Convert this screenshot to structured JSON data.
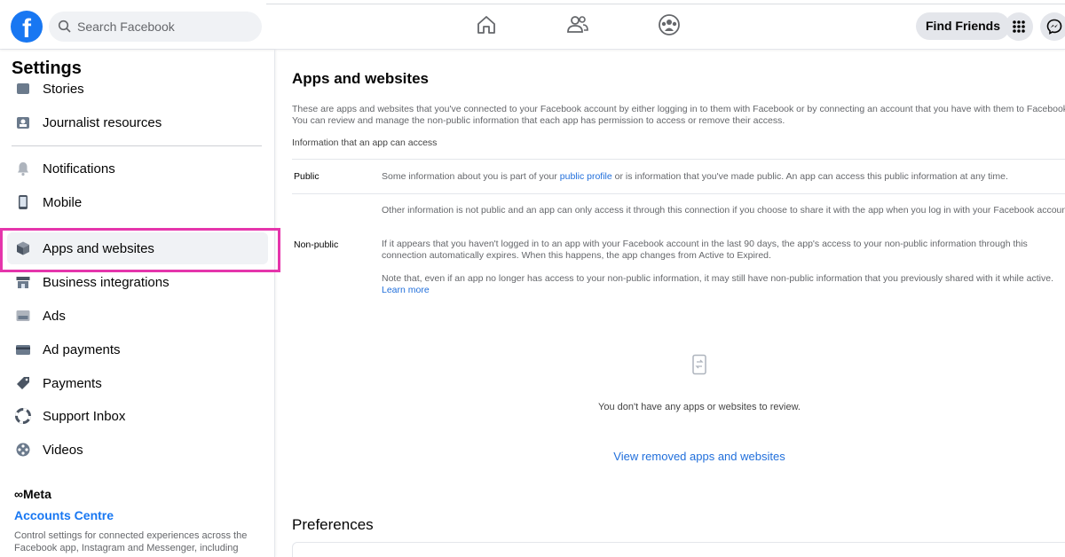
{
  "header": {
    "logo": "f",
    "search_placeholder": "Search Facebook",
    "find_friends": "Find Friends",
    "icons": [
      "home-icon",
      "friends-icon",
      "groups-icon",
      "menu-grid-icon",
      "messenger-icon"
    ]
  },
  "sidebar": {
    "title": "Settings",
    "items": [
      {
        "label": "Stories",
        "icon": "stories-icon"
      },
      {
        "label": "Journalist resources",
        "icon": "journalist-icon"
      },
      {
        "label": "Notifications",
        "icon": "bell-icon"
      },
      {
        "label": "Mobile",
        "icon": "mobile-icon"
      },
      {
        "label": "Apps and websites",
        "icon": "cube-icon"
      },
      {
        "label": "Business integrations",
        "icon": "business-icon"
      },
      {
        "label": "Ads",
        "icon": "ads-icon"
      },
      {
        "label": "Ad payments",
        "icon": "card-icon"
      },
      {
        "label": "Payments",
        "icon": "tag-icon"
      },
      {
        "label": "Support Inbox",
        "icon": "lifebuoy-icon"
      },
      {
        "label": "Videos",
        "icon": "film-icon"
      }
    ],
    "meta_label": "∞Meta",
    "accounts_centre": "Accounts Centre",
    "accounts_desc": "Control settings for connected experiences across the Facebook app, Instagram and Messenger, including"
  },
  "main": {
    "title": "Apps and websites",
    "intro": "These are apps and websites that you've connected to your Facebook account by either logging in to them with Facebook or by connecting an account that you have with them to Facebook. You can review and manage the non-public information that each app has permission to access or remove their access.",
    "info_head": "Information that an app can access",
    "public_label": "Public",
    "public_text_1": "Some information about you is part of your ",
    "public_link": "public profile",
    "public_text_2": " or is information that you've made public. An app can access this public information at any time.",
    "nonpublic_label": "Non-public",
    "nonpublic_p1": "Other information is not public and an app can only access it through this connection if you choose to share it with the app when you log in with your Facebook account.",
    "nonpublic_p2": "If it appears that you haven't logged in to an app with your Facebook account in the last 90 days, the app's access to your non-public information through this connection automatically expires. When this happens, the app changes from Active to Expired.",
    "nonpublic_p3": "Note that, even if an app no longer has access to your non-public information, it may still have non-public information that you previously shared with it while active. ",
    "learn_more": "Learn more",
    "empty_text": "You don't have any apps or websites to review.",
    "view_removed": "View removed apps and websites",
    "preferences": "Preferences"
  },
  "colors": {
    "accent": "#1877f2",
    "highlight": "#e535ab",
    "link": "#216fdb"
  }
}
